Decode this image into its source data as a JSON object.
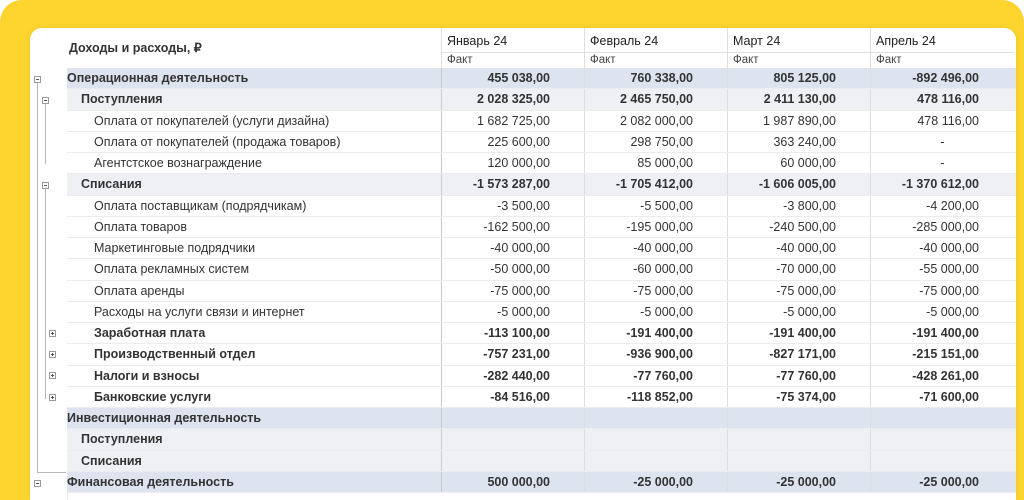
{
  "header": {
    "title": "Доходы и расходы, ₽",
    "columns": [
      {
        "month": "Январь 24",
        "sub": "Факт"
      },
      {
        "month": "Февраль 24",
        "sub": "Факт"
      },
      {
        "month": "Март 24",
        "sub": "Факт"
      },
      {
        "month": "Апрель 24",
        "sub": "Факт"
      }
    ]
  },
  "rows": [
    {
      "label": "Операционная деятельность",
      "values": [
        "455 038,00",
        "760 338,00",
        "805 125,00",
        "-892 496,00"
      ]
    },
    {
      "label": "Поступления",
      "values": [
        "2 028 325,00",
        "2 465 750,00",
        "2 411 130,00",
        "478 116,00"
      ]
    },
    {
      "label": "Оплата от покупателей (услуги дизайна)",
      "values": [
        "1 682 725,00",
        "2 082 000,00",
        "1 987 890,00",
        "478 116,00"
      ]
    },
    {
      "label": "Оплата от покупателей (продажа товаров)",
      "values": [
        "225 600,00",
        "298 750,00",
        "363 240,00",
        "-"
      ]
    },
    {
      "label": "Агентстское вознаграждение",
      "values": [
        "120 000,00",
        "85 000,00",
        "60 000,00",
        "-"
      ]
    },
    {
      "label": "Списания",
      "values": [
        "-1 573 287,00",
        "-1 705 412,00",
        "-1 606 005,00",
        "-1 370 612,00"
      ]
    },
    {
      "label": "Оплата поставщикам (подрядчикам)",
      "values": [
        "-3 500,00",
        "-5 500,00",
        "-3 800,00",
        "-4 200,00"
      ]
    },
    {
      "label": "Оплата товаров",
      "values": [
        "-162 500,00",
        "-195 000,00",
        "-240 500,00",
        "-285 000,00"
      ]
    },
    {
      "label": "Маркетинговые подрядчики",
      "values": [
        "-40 000,00",
        "-40 000,00",
        "-40 000,00",
        "-40 000,00"
      ]
    },
    {
      "label": "Оплата рекламных систем",
      "values": [
        "-50 000,00",
        "-60 000,00",
        "-70 000,00",
        "-55 000,00"
      ]
    },
    {
      "label": "Оплата аренды",
      "values": [
        "-75 000,00",
        "-75 000,00",
        "-75 000,00",
        "-75 000,00"
      ]
    },
    {
      "label": "Расходы на  услуги связи и интернет",
      "values": [
        "-5 000,00",
        "-5 000,00",
        "-5 000,00",
        "-5 000,00"
      ]
    },
    {
      "label": "Заработная плата",
      "values": [
        "-113 100,00",
        "-191 400,00",
        "-191 400,00",
        "-191 400,00"
      ]
    },
    {
      "label": "Производственный отдел",
      "values": [
        "-757 231,00",
        "-936 900,00",
        "-827 171,00",
        "-215 151,00"
      ]
    },
    {
      "label": "Налоги и взносы",
      "values": [
        "-282 440,00",
        "-77 760,00",
        "-77 760,00",
        "-428 261,00"
      ]
    },
    {
      "label": "Банковские услуги",
      "values": [
        "-84 516,00",
        "-118 852,00",
        "-75 374,00",
        "-71 600,00"
      ]
    },
    {
      "label": "Инвестиционная деятельность",
      "values": [
        "",
        "",
        "",
        ""
      ]
    },
    {
      "label": "Поступления",
      "values": [
        "",
        "",
        "",
        ""
      ]
    },
    {
      "label": "Списания",
      "values": [
        "",
        "",
        "",
        ""
      ]
    },
    {
      "label": "Финансовая деятельность",
      "values": [
        "500 000,00",
        "-25 000,00",
        "-25 000,00",
        "-25 000,00"
      ]
    }
  ]
}
